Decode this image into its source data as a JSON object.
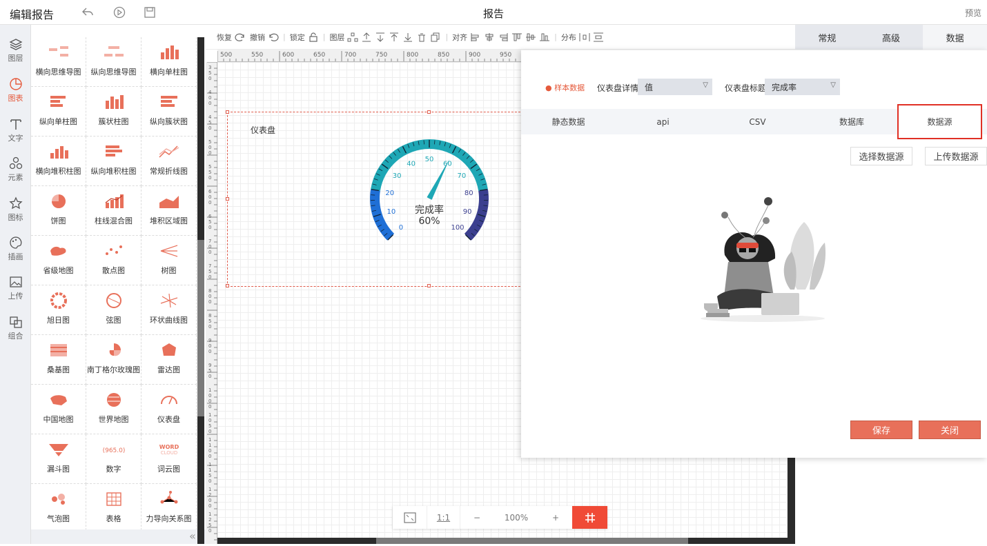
{
  "header": {
    "title": "编辑报告",
    "center_title": "报告",
    "preview": "预览"
  },
  "leftnav": [
    {
      "label": "图层",
      "active": false
    },
    {
      "label": "图表",
      "active": true
    },
    {
      "label": "文字",
      "active": false
    },
    {
      "label": "元素",
      "active": false
    },
    {
      "label": "图标",
      "active": false
    },
    {
      "label": "插画",
      "active": false
    },
    {
      "label": "上传",
      "active": false
    },
    {
      "label": "组合",
      "active": false
    }
  ],
  "palette": [
    "横向思维导图",
    "纵向思维导图",
    "横向单柱图",
    "纵向单柱图",
    "簇状柱图",
    "纵向簇状图",
    "横向堆积柱图",
    "纵向堆积柱图",
    "常规折线图",
    "饼图",
    "柱线混合图",
    "堆积区域图",
    "省级地图",
    "散点图",
    "树图",
    "旭日图",
    "弦图",
    "环状曲线图",
    "桑基图",
    "南丁格尔玫瑰图",
    "雷达图",
    "中国地图",
    "世界地图",
    "仪表盘",
    "漏斗图",
    "数字",
    "词云图",
    "气泡图",
    "表格",
    "力导向关系图"
  ],
  "palette_icon_text": {
    "number": "965.0",
    "word": "WORD",
    "cloud": "CLOUD"
  },
  "toolbar": {
    "redo": "恢复",
    "undo": "撤销",
    "lock": "锁定",
    "layer": "图层",
    "align": "对齐",
    "distribute": "分布"
  },
  "right_tabs": [
    {
      "label": "常规",
      "active": false
    },
    {
      "label": "高级",
      "active": false
    },
    {
      "label": "数据",
      "active": true
    }
  ],
  "ruler": {
    "h_ticks": [
      "500",
      "550",
      "600",
      "650",
      "700",
      "750",
      "800",
      "850",
      "900",
      "950"
    ],
    "v_ticks": [
      "350",
      "400",
      "450",
      "500",
      "550",
      "600",
      "650",
      "700",
      "750",
      "800",
      "850",
      "900",
      "950",
      "1000",
      "1050",
      "1100",
      "1150",
      "1200",
      "1250"
    ]
  },
  "widget": {
    "title": "仪表盘"
  },
  "gauge": {
    "label": "完成率",
    "value_text": "60%",
    "value": 60,
    "min": 0,
    "max": 100,
    "ticks": [
      "0",
      "10",
      "20",
      "30",
      "40",
      "50",
      "60",
      "70",
      "80",
      "90",
      "100"
    ],
    "colors": {
      "low": "#1f6fd6",
      "mid": "#1ea7b5",
      "high": "#3b3f8f"
    }
  },
  "zoombar": {
    "one_to_one": "1:1",
    "minus": "−",
    "zoom": "100%",
    "plus": "+",
    "grid_icon": "grid-icon"
  },
  "panel": {
    "sample_data": "样本数据",
    "detail_label": "仪表盘详情",
    "detail_value": "值",
    "title_label": "仪表盘标题",
    "title_value": "完成率",
    "tabs": [
      "静态数据",
      "api",
      "CSV",
      "数据库",
      "数据源"
    ],
    "active_tab": "数据源",
    "select_source": "选择数据源",
    "upload_source": "上传数据源",
    "save": "保存",
    "close": "关闭"
  },
  "colors": {
    "accent": "#e55a3c",
    "button_red": "#e8705a",
    "highlight_border": "#e02f24"
  }
}
